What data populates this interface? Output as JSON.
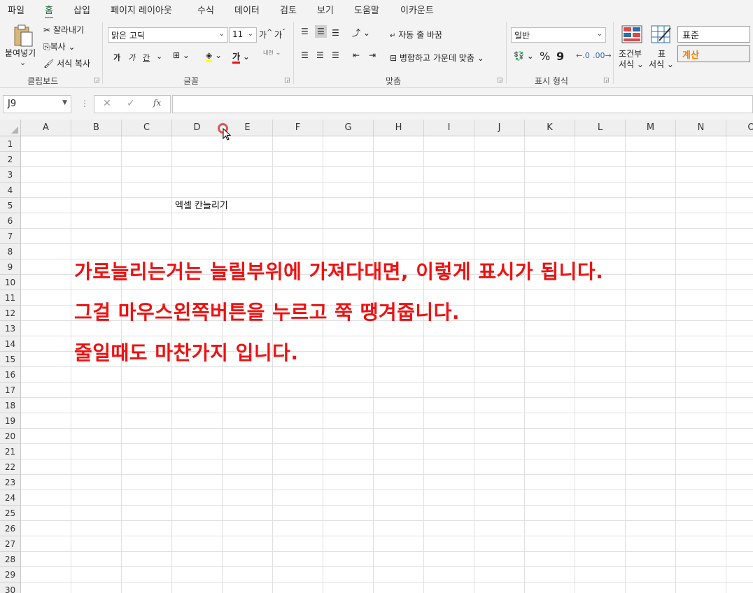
{
  "menu": {
    "tabs": [
      "파일",
      "홈",
      "삽입",
      "페이지 레이아웃",
      "수식",
      "데이터",
      "검토",
      "보기",
      "도움말",
      "이카운트"
    ],
    "active": "홈"
  },
  "ribbon": {
    "clipboard": {
      "paste": "붙여넣기",
      "cut": "잘라내기",
      "copy": "복사",
      "format_painter": "서식 복사",
      "label": "클립보드"
    },
    "font": {
      "font_name": "맑은 고딕",
      "font_size": "11",
      "grow": "가",
      "shrink": "가",
      "bold": "가",
      "italic": "가",
      "underline": "간",
      "font_color": "가",
      "phonetic": "내천",
      "label": "글꼴"
    },
    "alignment": {
      "wrap_text": "자동 줄 바꿈",
      "merge_center": "병합하고 가운데 맞춤",
      "label": "맞춤"
    },
    "number": {
      "format": "일반",
      "percent": "%",
      "comma": "9",
      "label": "표시 형식"
    },
    "styles": {
      "conditional_line1": "조건부",
      "conditional_line2": "서식",
      "table_line1": "표",
      "table_line2": "서식",
      "style_normal": "표준",
      "style_calc": "계산"
    }
  },
  "formula_bar": {
    "name_box": "J9",
    "fx": "fx",
    "formula": ""
  },
  "sheet": {
    "columns": [
      "A",
      "B",
      "C",
      "D",
      "E",
      "F",
      "G",
      "H",
      "I",
      "J",
      "K",
      "L",
      "M",
      "N",
      "O"
    ],
    "rows": [
      "1",
      "2",
      "3",
      "4",
      "5",
      "6",
      "7",
      "8",
      "9",
      "10",
      "11",
      "12",
      "13",
      "14",
      "15",
      "16",
      "17",
      "18",
      "19",
      "20",
      "21",
      "22",
      "23",
      "24",
      "25",
      "26",
      "27",
      "28",
      "29",
      "30"
    ],
    "cell_d5": "엑셀 칸늘리기",
    "annotations": [
      "가로늘리는거는 늘릴부위에 가져다대면, 이렇게 표시가 됩니다.",
      "그걸 마우스왼쪽버튼을 누르고 쭉 땡겨줍니다.",
      "줄일때도 마찬가지 입니다."
    ]
  },
  "colors": {
    "accent": "#1e6b3c",
    "annotation": "#ee1111",
    "calc_style": "#fa7d00"
  }
}
